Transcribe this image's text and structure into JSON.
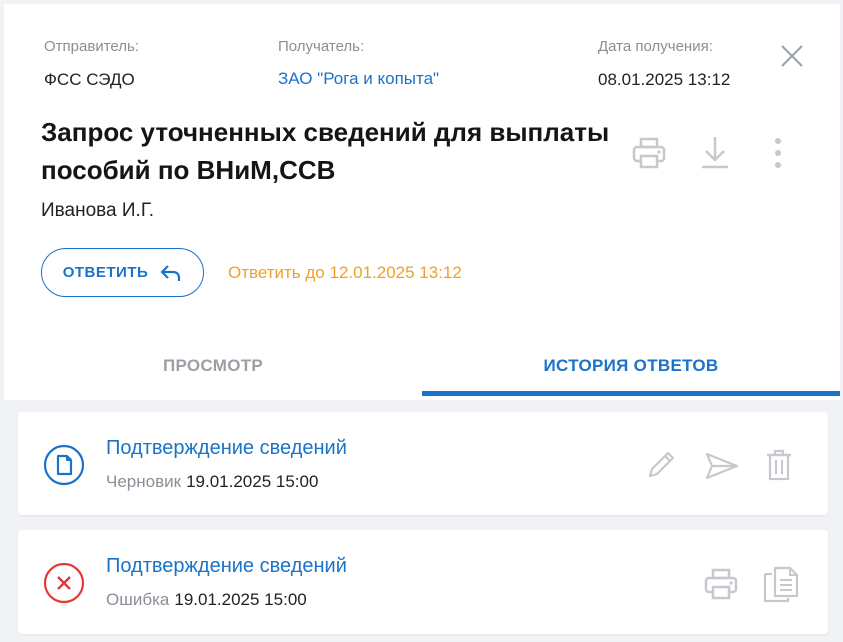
{
  "header": {
    "sender_label": "Отправитель:",
    "sender_value": "ФСС СЭДО",
    "recipient_label": "Получатель:",
    "recipient_value": "ЗАО \"Рога и копыта\"",
    "date_label": "Дата получения:",
    "date_value": "08.01.2025 13:12"
  },
  "document": {
    "title": "Запрос уточненных сведений для выплаты пособий по ВНиМ,ССВ",
    "author": "Иванова И.Г."
  },
  "actions": {
    "reply_label": "ОТВЕТИТЬ",
    "reply_deadline": "Ответить до 12.01.2025 13:12"
  },
  "tabs": [
    {
      "label": "ПРОСМОТР",
      "active": false
    },
    {
      "label": "ИСТОРИЯ ОТВЕТОВ",
      "active": true
    }
  ],
  "responses": [
    {
      "title": "Подтверждение сведений",
      "status": "Черновик",
      "date": "19.01.2025 15:00",
      "icon": "document-icon",
      "color": "#1a73c8"
    },
    {
      "title": "Подтверждение сведений",
      "status": "Ошибка",
      "date": "19.01.2025 15:00",
      "icon": "error-icon",
      "color": "#e53935"
    }
  ],
  "colors": {
    "accent": "#1a73c8",
    "warning": "#f0a028",
    "error": "#e53935",
    "muted_icon": "#c5c9ce"
  }
}
